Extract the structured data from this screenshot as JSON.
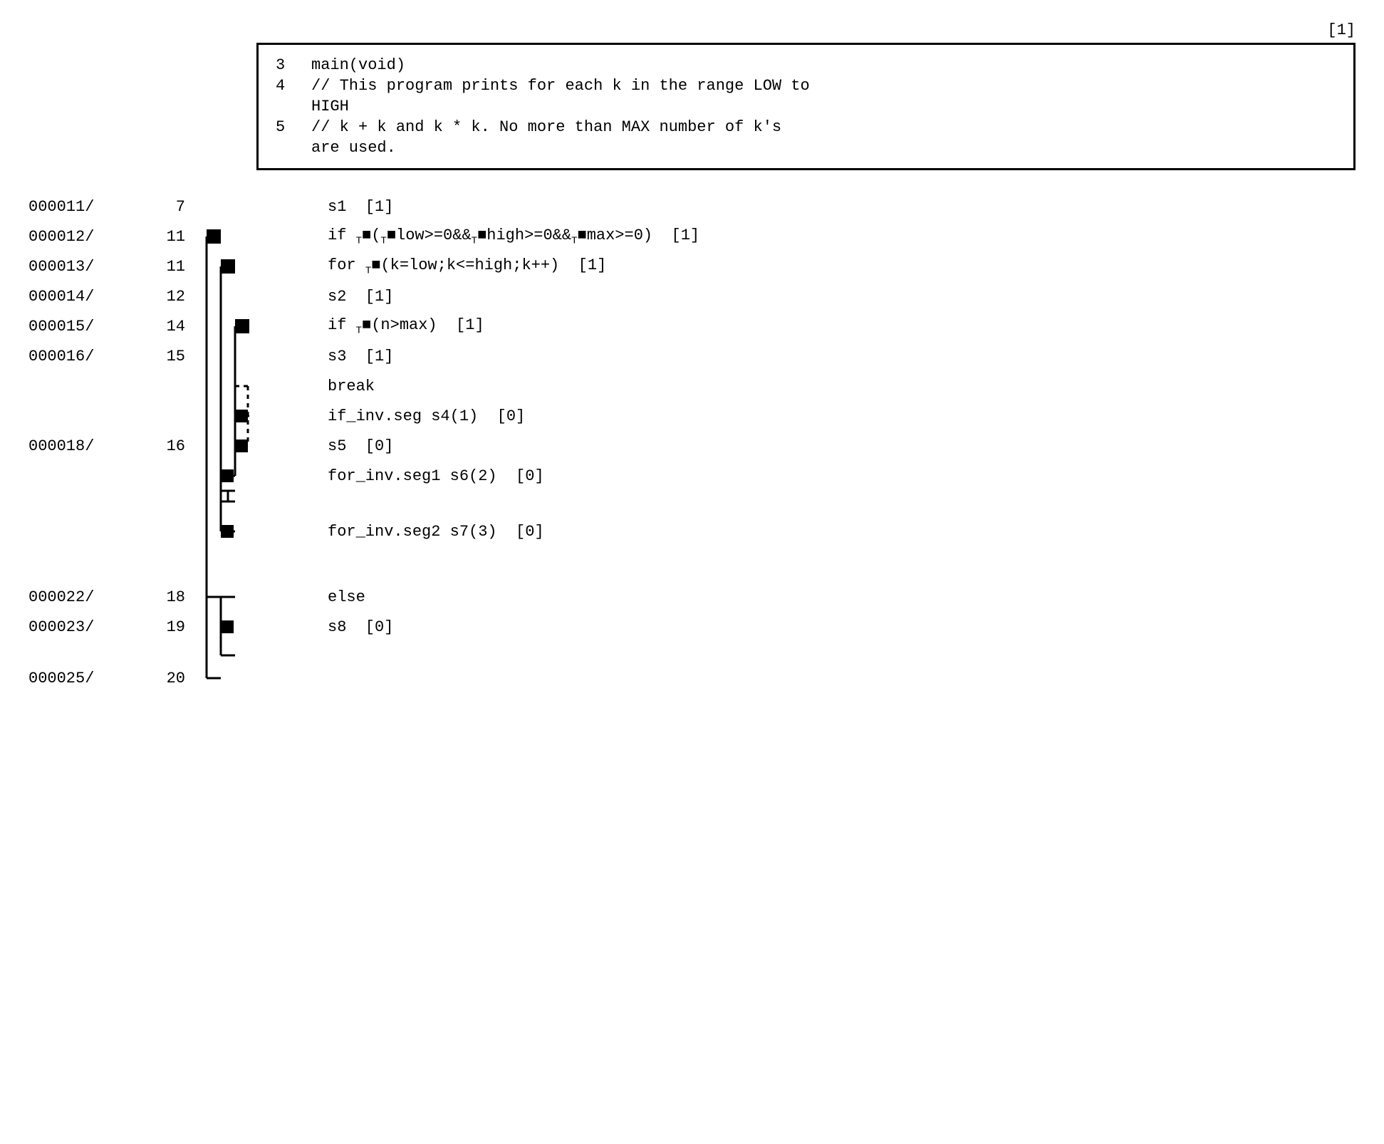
{
  "top_ref": "[1]",
  "comment_block": {
    "lines": [
      {
        "num": "3",
        "text": "main(void)"
      },
      {
        "num": "4",
        "text": "// This program prints for each k in the range LOW to"
      },
      {
        "num": "4",
        "text": "HIGH"
      },
      {
        "num": "5",
        "text": "// k + k and k * k.  No more than MAX number of k's"
      },
      {
        "num": "5",
        "text": "are used."
      }
    ]
  },
  "code_rows": [
    {
      "addr": "000011/",
      "line": "7",
      "indent": 0,
      "marker": false,
      "code": "s1  [1]",
      "flow_type": "plain"
    },
    {
      "addr": "000012/",
      "line": "11",
      "indent": 1,
      "marker": true,
      "code": "if T■(T■low>=0&&T■high>=0&&T■max>=0)  [1]",
      "flow_type": "if_open"
    },
    {
      "addr": "000013/",
      "line": "11",
      "indent": 1,
      "marker": true,
      "code": "for T■(k=low;k<=high;k++)  [1]",
      "flow_type": "for_open"
    },
    {
      "addr": "000014/",
      "line": "12",
      "indent": 2,
      "marker": false,
      "code": "s2  [1]",
      "flow_type": "plain"
    },
    {
      "addr": "000015/",
      "line": "14",
      "indent": 2,
      "marker": true,
      "code": "if T■(n>max)  [1]",
      "flow_type": "if2_open"
    },
    {
      "addr": "000016/",
      "line": "15",
      "indent": 3,
      "marker": false,
      "code": "s3  [1]",
      "flow_type": "plain"
    },
    {
      "addr": "",
      "line": "",
      "indent": 3,
      "marker": false,
      "code": "break",
      "flow_type": "break"
    },
    {
      "addr": "",
      "line": "",
      "indent": 2,
      "marker": true,
      "code": "if_inv.seg s4(1)  [0]",
      "flow_type": "if_inv"
    },
    {
      "addr": "000018/",
      "line": "16",
      "indent": 2,
      "marker": true,
      "code": "s5  [0]",
      "flow_type": "s5"
    },
    {
      "addr": "",
      "line": "",
      "indent": 1,
      "marker": true,
      "code": "for_inv.seg1 s6(2)  [0]",
      "flow_type": "for_inv1"
    },
    {
      "addr": "",
      "line": "",
      "indent": 1,
      "marker": true,
      "code": "for_inv.seg2 s7(3)  [0]",
      "flow_type": "for_inv2"
    },
    {
      "addr": "000022/",
      "line": "18",
      "indent": 0,
      "marker": false,
      "code": "else",
      "flow_type": "else"
    },
    {
      "addr": "000023/",
      "line": "19",
      "indent": 1,
      "marker": true,
      "code": "s8  [0]",
      "flow_type": "s8"
    },
    {
      "addr": "000025/",
      "line": "20",
      "indent": 0,
      "marker": false,
      "code": "",
      "flow_type": "end"
    }
  ]
}
